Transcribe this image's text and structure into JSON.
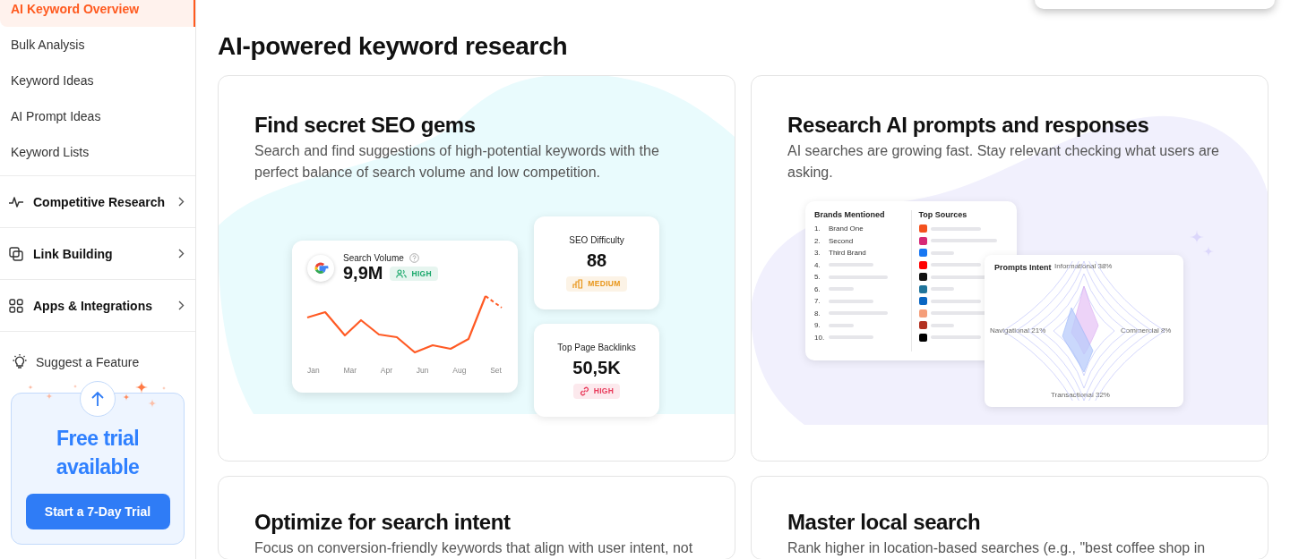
{
  "sidebar": {
    "nav_items": [
      {
        "label": "AI Keyword Overview",
        "selected": true
      },
      {
        "label": "Bulk Analysis",
        "selected": false
      },
      {
        "label": "Keyword Ideas",
        "selected": false
      },
      {
        "label": "AI Prompt Ideas",
        "selected": false
      },
      {
        "label": "Keyword Lists",
        "selected": false
      }
    ],
    "sections": [
      {
        "label": "Competitive Research"
      },
      {
        "label": "Link Building"
      },
      {
        "label": "Apps & Integrations"
      }
    ],
    "suggest": "Suggest a Feature",
    "trial": {
      "title": "Free trial available",
      "button": "Start a 7-Day Trial"
    }
  },
  "main": {
    "title": "AI-powered keyword research",
    "cards": [
      {
        "kind": "volume",
        "title": "Find secret SEO gems",
        "description": "Search and find suggestions of high-potential keywords with the perfect balance of search volume and low competition.",
        "volume": {
          "label": "Search Volume",
          "value": "9,9M",
          "badge": "HIGH",
          "months": [
            "Jan",
            "Mar",
            "Apr",
            "Jun",
            "Aug",
            "Set"
          ]
        },
        "metrics": [
          {
            "label": "SEO Difficulty",
            "value": "88",
            "badge": "MEDIUM",
            "kind": "difficulty"
          },
          {
            "label": "Top Page Backlinks",
            "value": "50,5K",
            "badge": "HIGH",
            "kind": "backlinks"
          }
        ]
      },
      {
        "kind": "prompts",
        "title": "Research AI prompts and responses",
        "description": "AI searches are growing fast. Stay relevant checking what users are asking.",
        "brands": {
          "title": "Brands Mentioned",
          "items": [
            {
              "number": "1.",
              "name": "Brand One"
            },
            {
              "number": "2.",
              "name": "Second"
            },
            {
              "number": "3.",
              "name": "Third Brand"
            },
            {
              "number": "4."
            },
            {
              "number": "5."
            },
            {
              "number": "6."
            },
            {
              "number": "7."
            },
            {
              "number": "8."
            },
            {
              "number": "9."
            },
            {
              "number": "10."
            }
          ]
        },
        "sources": {
          "title": "Top Sources",
          "items": [
            {
              "color": "#f4511e"
            },
            {
              "color": "#d62976"
            },
            {
              "color": "#1877f2"
            },
            {
              "color": "#ff0000"
            },
            {
              "color": "#111111"
            },
            {
              "color": "#21759b"
            },
            {
              "color": "#0a66c2"
            },
            {
              "color": "#f59e7a"
            },
            {
              "color": "#b23121"
            },
            {
              "color": "#000000"
            }
          ]
        },
        "intent": {
          "title": "Prompts Intent",
          "top": "Informational 38%",
          "right": "Commercial 8%",
          "bottom": "Transactional 32%",
          "left": "Navigational 21%"
        }
      },
      {
        "kind": "text",
        "title": "Optimize for search intent",
        "description": "Focus on conversion-friendly keywords that align with user intent, not"
      },
      {
        "kind": "text",
        "title": "Master local search",
        "description": "Rank higher in location-based searches (e.g., \"best coffee shop in"
      }
    ]
  }
}
